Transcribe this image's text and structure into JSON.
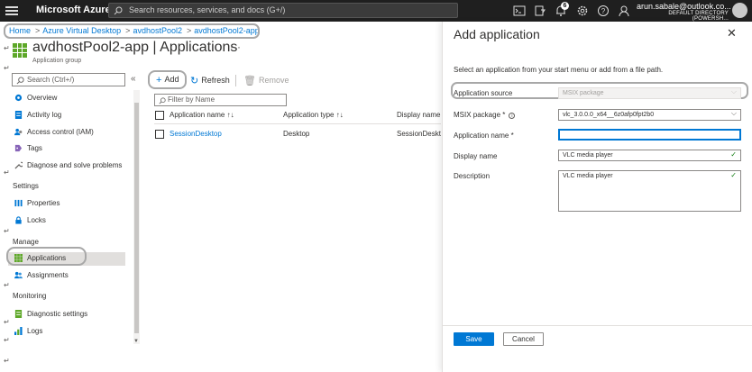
{
  "topbar": {
    "brand": "Microsoft Azure",
    "search_placeholder": "Search resources, services, and docs (G+/)",
    "notification_count": "6",
    "user_email": "arun.sabale@outlook.co...",
    "user_directory": "DEFAULT DIRECTORY (POWERSH...",
    "icons": [
      "cloud-shell-icon",
      "directory-filter-icon",
      "bell-icon",
      "gear-icon",
      "help-icon",
      "feedback-icon"
    ]
  },
  "breadcrumb": [
    "Home",
    "Azure Virtual Desktop",
    "avdhostPool2",
    "avdhostPool2-app"
  ],
  "page": {
    "title": "avdhostPool2-app | Applications",
    "more": "···",
    "subtitle": "Application group"
  },
  "sidebar": {
    "search_placeholder": "Search (Ctrl+/)",
    "collapse": "«",
    "items_top": [
      {
        "label": "Overview",
        "icon": "overview-icon",
        "color": "#0078d4"
      },
      {
        "label": "Activity log",
        "icon": "activity-log-icon",
        "color": "#0078d4"
      },
      {
        "label": "Access control (IAM)",
        "icon": "iam-icon",
        "color": "#0078d4"
      },
      {
        "label": "Tags",
        "icon": "tag-icon",
        "color": "#8764b8"
      },
      {
        "label": "Diagnose and solve problems",
        "icon": "wrench-icon",
        "color": "#605e5c"
      }
    ],
    "section_settings": "Settings",
    "items_settings": [
      {
        "label": "Properties",
        "icon": "properties-icon",
        "color": "#0078d4"
      },
      {
        "label": "Locks",
        "icon": "lock-icon",
        "color": "#0078d4"
      }
    ],
    "section_manage": "Manage",
    "items_manage": [
      {
        "label": "Applications",
        "icon": "applications-icon",
        "color": "#5ea829"
      },
      {
        "label": "Assignments",
        "icon": "users-icon",
        "color": "#0078d4"
      }
    ],
    "section_monitoring": "Monitoring",
    "items_monitoring": [
      {
        "label": "Diagnostic settings",
        "icon": "diagnostic-icon",
        "color": "#5ea829"
      },
      {
        "label": "Logs",
        "icon": "logs-icon",
        "color": "#0078d4"
      }
    ]
  },
  "toolbar": {
    "add": "Add",
    "refresh": "Refresh",
    "remove": "Remove"
  },
  "filter_placeholder": "Filter by Name",
  "table": {
    "headers": [
      "Application name ↑↓",
      "Application type ↑↓",
      "Display name"
    ],
    "rows": [
      {
        "name": "SessionDesktop",
        "type": "Desktop",
        "display": "SessionDesktop"
      }
    ]
  },
  "panel": {
    "title": "Add application",
    "intro": "Select an application from your start menu or add from a file path.",
    "fields": {
      "source_label": "Application source",
      "source_value": "MSIX package",
      "msix_label": "MSIX package *",
      "msix_value": "vlc_3.0.0.0_x64__6z0afp0fpt2b0",
      "appname_label": "Application name *",
      "appname_value": "",
      "display_label": "Display name",
      "display_value": "VLC media player",
      "description_label": "Description",
      "description_value": "VLC media player"
    },
    "save": "Save",
    "cancel": "Cancel"
  },
  "colors": {
    "topbar": "#1f1f1f",
    "accent": "#0078d4",
    "success": "#107c10",
    "highlight_ring": "#a8a8a8"
  }
}
